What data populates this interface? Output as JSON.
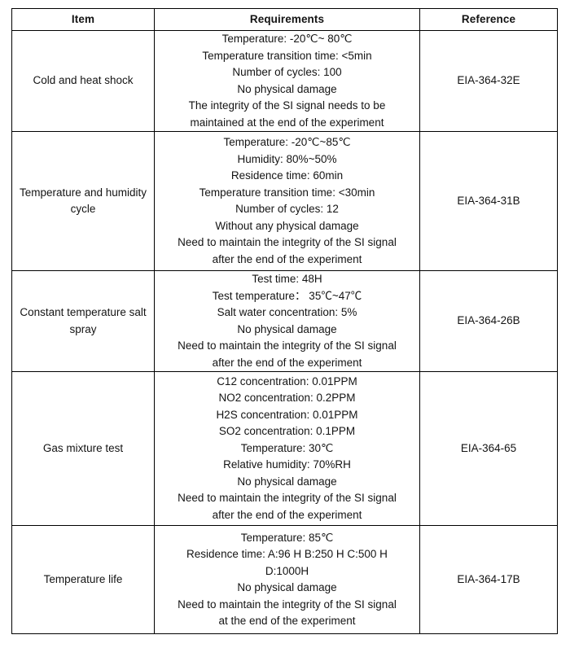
{
  "table": {
    "columns": [
      {
        "key": "item",
        "label": "Item"
      },
      {
        "key": "requirements",
        "label": "Requirements"
      },
      {
        "key": "reference",
        "label": "Reference"
      }
    ],
    "rows": [
      {
        "item": "Cold and heat shock",
        "requirements": [
          "Temperature: -20℃~ 80℃",
          "Temperature transition time: <5min",
          "Number of cycles: 100",
          "No physical damage",
          "The integrity of the SI signal needs to be",
          "maintained at the end of the experiment"
        ],
        "reference": "EIA-364-32E"
      },
      {
        "item": "Temperature and humidity cycle",
        "requirements": [
          "Temperature: -20℃~85℃",
          "Humidity: 80%~50%",
          "Residence time: 60min",
          "Temperature transition time: <30min",
          "Number of cycles: 12",
          "Without any physical damage",
          "Need to maintain the integrity of the SI signal",
          "after the end of the experiment"
        ],
        "reference": "EIA-364-31B"
      },
      {
        "item": "Constant temperature salt spray",
        "requirements": [
          "Test time: 48H",
          "Test temperature： 35℃~47℃",
          "Salt water concentration: 5%",
          "No physical damage",
          "Need to maintain the integrity of the SI signal",
          "after the end of the experiment"
        ],
        "reference": "EIA-364-26B"
      },
      {
        "item": "Gas mixture test",
        "requirements": [
          "C12 concentration: 0.01PPM",
          "NO2 concentration: 0.2PPM",
          "H2S concentration: 0.01PPM",
          "SO2 concentration: 0.1PPM",
          "Temperature: 30℃",
          "Relative humidity: 70%RH",
          "No physical damage",
          "Need to maintain the integrity of the SI signal",
          "after the end of the experiment"
        ],
        "reference": "EIA-364-65"
      },
      {
        "item": "Temperature life",
        "requirements": [
          "Temperature: 85℃",
          "Residence time: A:96 H B:250 H C:500 H",
          "D:1000H",
          "No physical damage",
          "Need to maintain the integrity of the SI signal",
          "at the end of the experiment"
        ],
        "reference": "EIA-364-17B"
      }
    ]
  },
  "style": {
    "border_color": "#000000",
    "text_color": "#141414",
    "background": "#ffffff"
  }
}
